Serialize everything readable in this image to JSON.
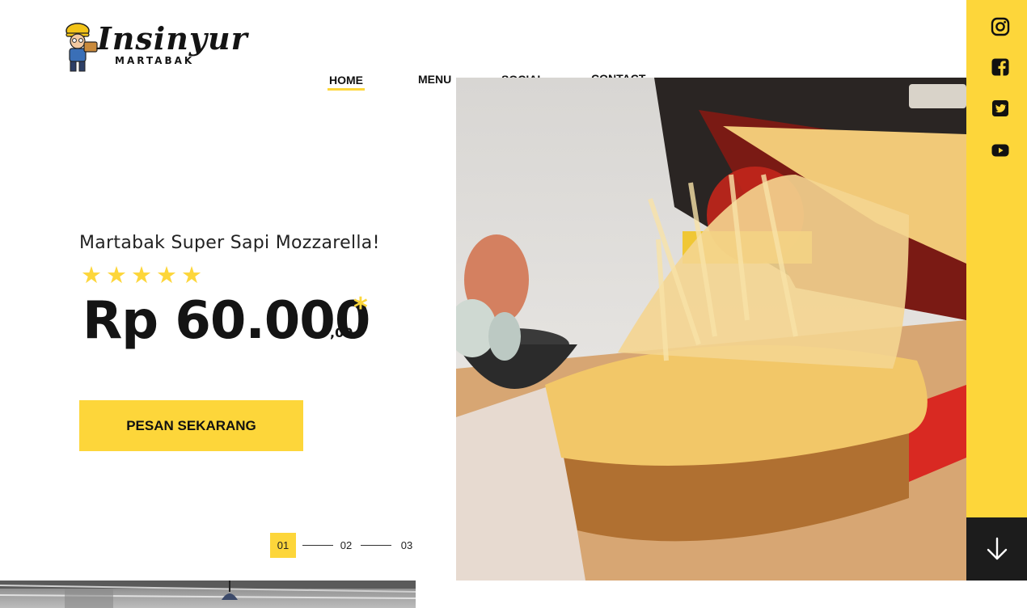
{
  "logo": {
    "word": "Insinyur",
    "sub": "MARTABAK",
    "mascot": "engineer-mascot"
  },
  "nav": {
    "items": [
      {
        "label": "HOME",
        "active": true
      },
      {
        "label": "MENU",
        "active": false
      },
      {
        "label": "SOCIAL",
        "active": false
      },
      {
        "label": "CONTACT",
        "active": false
      }
    ]
  },
  "hero": {
    "product_name": "Martabak Super Sapi Mozzarella!",
    "stars": [
      "★",
      "★",
      "★",
      "★",
      "★"
    ],
    "rating": 5,
    "price": "Rp 60.000",
    "cents": ",00",
    "asterisk": "*",
    "cta_label": "PESAN SEKARANG",
    "image": "cheesy-martabak-photo"
  },
  "pager": {
    "items": [
      "01",
      "02",
      "03"
    ],
    "active_index": 0
  },
  "social": {
    "icons": [
      "instagram-icon",
      "facebook-icon",
      "twitter-icon",
      "youtube-icon"
    ]
  },
  "scroll_icon": "arrow-down-icon",
  "colors": {
    "accent": "#fdd63a",
    "dark": "#1c1c1c",
    "text": "#141414"
  }
}
